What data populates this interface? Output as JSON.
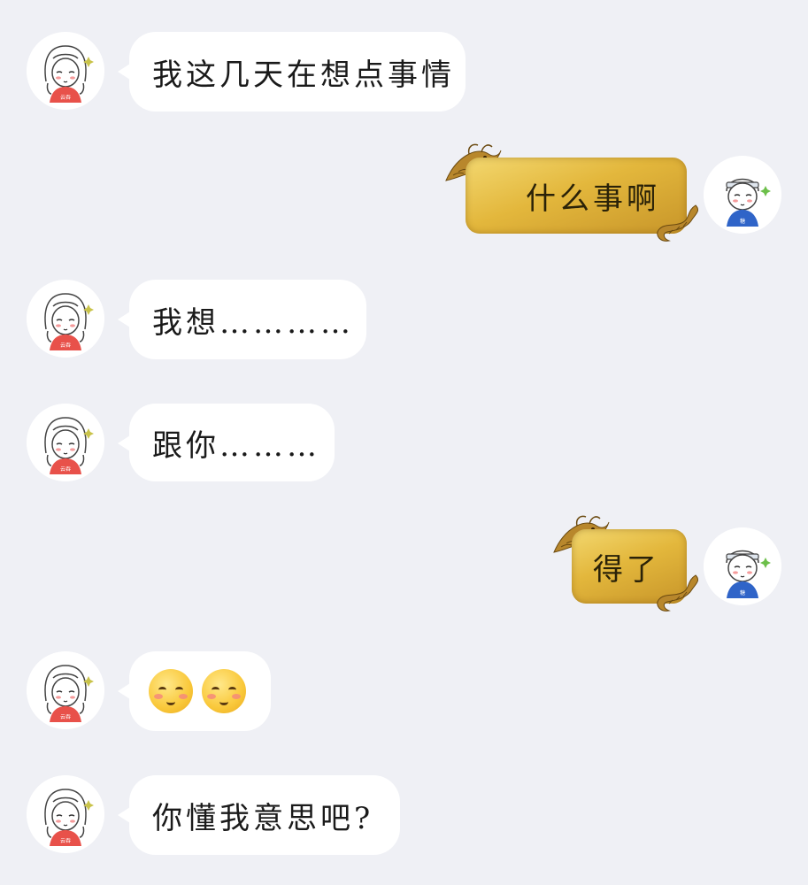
{
  "chat": {
    "messages": [
      {
        "sender": "contact",
        "type": "text",
        "text": "我这几天在想点事情"
      },
      {
        "sender": "me",
        "type": "text",
        "text": "什么事啊"
      },
      {
        "sender": "contact",
        "type": "text",
        "text": "我想…………"
      },
      {
        "sender": "contact",
        "type": "text",
        "text": "跟你………"
      },
      {
        "sender": "me",
        "type": "text",
        "text": "得了"
      },
      {
        "sender": "contact",
        "type": "emoji",
        "emoji": [
          "blush-face-emoji",
          "blush-face-emoji"
        ]
      },
      {
        "sender": "contact",
        "type": "text",
        "text": "你懂我意思吧?"
      }
    ]
  },
  "avatars": {
    "contact": {
      "icon": "girl-avatar-icon",
      "shirt_color": "#e8514a",
      "shirt_text": "云吞"
    },
    "me": {
      "icon": "boy-avatar-icon",
      "shirt_color": "#2f64c8",
      "shirt_text": "糖"
    }
  },
  "colors": {
    "background": "#eff0f5",
    "incoming_bubble": "#ffffff",
    "outgoing_bubble_gold": "#e3b73c"
  }
}
